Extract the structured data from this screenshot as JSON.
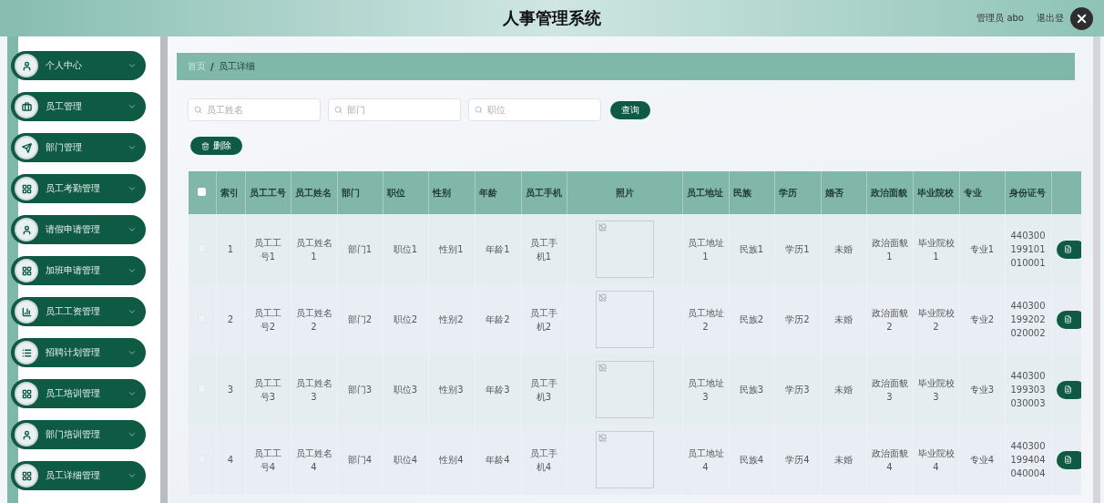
{
  "header": {
    "title": "人事管理系统",
    "user": "管理员 abo",
    "logout": "退出登"
  },
  "sidebar": {
    "items": [
      {
        "label": "个人中心",
        "kind": "user",
        "expanded": false
      },
      {
        "label": "员工管理",
        "kind": "briefcase",
        "expanded": false
      },
      {
        "label": "部门管理",
        "kind": "send",
        "expanded": false
      },
      {
        "label": "员工考勤管理",
        "kind": "grid",
        "expanded": false
      },
      {
        "label": "请假申请管理",
        "kind": "user",
        "expanded": false
      },
      {
        "label": "加班申请管理",
        "kind": "grid",
        "expanded": false
      },
      {
        "label": "员工工资管理",
        "kind": "chart",
        "expanded": false
      },
      {
        "label": "招聘计划管理",
        "kind": "list",
        "expanded": false
      },
      {
        "label": "员工培训管理",
        "kind": "grid",
        "expanded": false
      },
      {
        "label": "部门培训管理",
        "kind": "user",
        "expanded": false
      },
      {
        "label": "员工详细管理",
        "kind": "grid",
        "expanded": false
      }
    ]
  },
  "breadcrumb": {
    "items": [
      "首页",
      "员工详细"
    ],
    "separator": "/"
  },
  "search": {
    "fields": [
      {
        "placeholder": "员工姓名"
      },
      {
        "placeholder": "部门"
      },
      {
        "placeholder": "职位"
      }
    ],
    "button": "查询"
  },
  "delete_button": "删除",
  "table": {
    "header_checked": false,
    "columns": [
      {
        "label": "索引",
        "kind": "text"
      },
      {
        "label": "员工工号",
        "kind": "text"
      },
      {
        "label": "员工姓名",
        "kind": "text"
      },
      {
        "label": "部门",
        "kind": "text"
      },
      {
        "label": "职位",
        "kind": "text"
      },
      {
        "label": "性别",
        "kind": "text"
      },
      {
        "label": "年龄",
        "kind": "text"
      },
      {
        "label": "员工手机",
        "kind": "text"
      },
      {
        "label": "照片",
        "kind": "photo"
      },
      {
        "label": "员工地址",
        "kind": "text"
      },
      {
        "label": "民族",
        "kind": "text"
      },
      {
        "label": "学历",
        "kind": "text"
      },
      {
        "label": "婚否",
        "kind": "text"
      },
      {
        "label": "政治面貌",
        "kind": "text"
      },
      {
        "label": "毕业院校",
        "kind": "text"
      },
      {
        "label": "专业",
        "kind": "text"
      },
      {
        "label": "身份证号",
        "kind": "text"
      }
    ],
    "rows": [
      {
        "checked": false,
        "cells": [
          "1",
          "员工工号1",
          "员工姓名1",
          "部门1",
          "职位1",
          "性别1",
          "年龄1",
          "员工手机1",
          {
            "kind": "broken_image"
          },
          "员工地址1",
          "民族1",
          "学历1",
          "未婚",
          "政治面貌1",
          "毕业院校1",
          "专业1",
          "440300199101010001"
        ]
      },
      {
        "checked": false,
        "cells": [
          "2",
          "员工工号2",
          "员工姓名2",
          "部门2",
          "职位2",
          "性别2",
          "年龄2",
          "员工手机2",
          {
            "kind": "broken_image"
          },
          "员工地址2",
          "民族2",
          "学历2",
          "未婚",
          "政治面貌2",
          "毕业院校2",
          "专业2",
          "440300199202020002"
        ]
      },
      {
        "checked": false,
        "cells": [
          "3",
          "员工工号3",
          "员工姓名3",
          "部门3",
          "职位3",
          "性别3",
          "年龄3",
          "员工手机3",
          {
            "kind": "broken_image"
          },
          "员工地址3",
          "民族3",
          "学历3",
          "未婚",
          "政治面貌3",
          "毕业院校3",
          "专业3",
          "440300199303030003"
        ]
      },
      {
        "checked": false,
        "cells": [
          "4",
          "员工工号4",
          "员工姓名4",
          "部门4",
          "职位4",
          "性别4",
          "年龄4",
          "员工手机4",
          {
            "kind": "broken_image"
          },
          "员工地址4",
          "民族4",
          "学历4",
          "未婚",
          "政治面貌4",
          "毕业院校4",
          "专业4",
          "440300199404040004"
        ]
      }
    ]
  }
}
